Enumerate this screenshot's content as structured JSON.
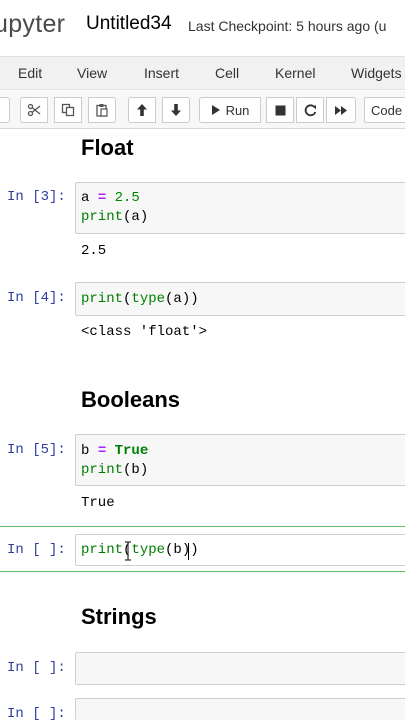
{
  "header": {
    "logo": "upyter",
    "notebook_title": "Untitled34",
    "checkpoint": "Last Checkpoint: 5 hours ago",
    "trusted_fragment": "(u"
  },
  "menu": [
    "Edit",
    "View",
    "Insert",
    "Cell",
    "Kernel",
    "Widgets"
  ],
  "toolbar": {
    "run_label": "Run",
    "cell_type": "Code"
  },
  "cells": {
    "float_heading": "Float",
    "c1": {
      "prompt": "In [3]:",
      "line1_var": "a",
      "line1_op": "=",
      "line1_num": "2.5",
      "line2_fn": "print",
      "line2_arg": "(a)",
      "output": "2.5"
    },
    "c2": {
      "prompt": "In [4]:",
      "fn1": "print",
      "p1": "(",
      "fn2": "type",
      "rest": "(a))",
      "output": "<class 'float'>"
    },
    "booleans_heading": "Booleans",
    "c3": {
      "prompt": "In [5]:",
      "line1_var": "b",
      "line1_op": "=",
      "line1_kw": "True",
      "line2_fn": "print",
      "line2_arg": "(b)",
      "output": "True"
    },
    "c4": {
      "prompt": "In [ ]:",
      "fn1": "print",
      "p1": "(",
      "fn2": "type",
      "rest": "(b))"
    },
    "strings_heading": "Strings",
    "c5": {
      "prompt": "In [ ]:"
    },
    "c6": {
      "prompt": "In [ ]:"
    }
  }
}
